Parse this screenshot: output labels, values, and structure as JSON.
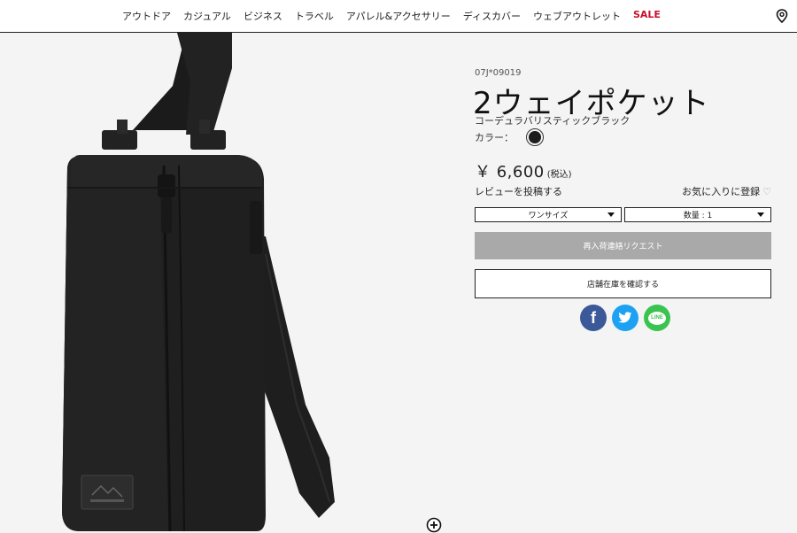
{
  "nav": {
    "items": [
      {
        "label": "アウトドア"
      },
      {
        "label": "カジュアル"
      },
      {
        "label": "ビジネス"
      },
      {
        "label": "トラベル"
      },
      {
        "label": "アパレル&アクセサリー"
      },
      {
        "label": "ディスカバー"
      },
      {
        "label": "ウェブアウトレット"
      },
      {
        "label": "SALE"
      }
    ]
  },
  "product": {
    "sku": "07J*09019",
    "title": "2ウェイポケット",
    "color_name": "コーデュラバリスティックブラック",
    "color_label": "カラー：",
    "swatch_color": "#1c1c1c",
    "price": "￥ 6,600",
    "tax_note": "(税込)",
    "review_link": "レビューを投稿する",
    "favorite": "お気に入りに登録",
    "size_select": "ワンサイズ",
    "qty_select": "数量 : 1",
    "restock_button": "再入荷連絡リクエスト",
    "stock_button": "店舗在庫を確認する"
  },
  "share": {
    "facebook_icon": "facebook-icon",
    "twitter_icon": "twitter-icon",
    "line_icon": "line-icon",
    "line_text": "LINE"
  },
  "colors": {
    "sale": "#c8102e",
    "facebook": "#3b5998",
    "twitter": "#1da1f2",
    "line": "#3ac34f",
    "disabled_button": "#a9a9a9"
  }
}
